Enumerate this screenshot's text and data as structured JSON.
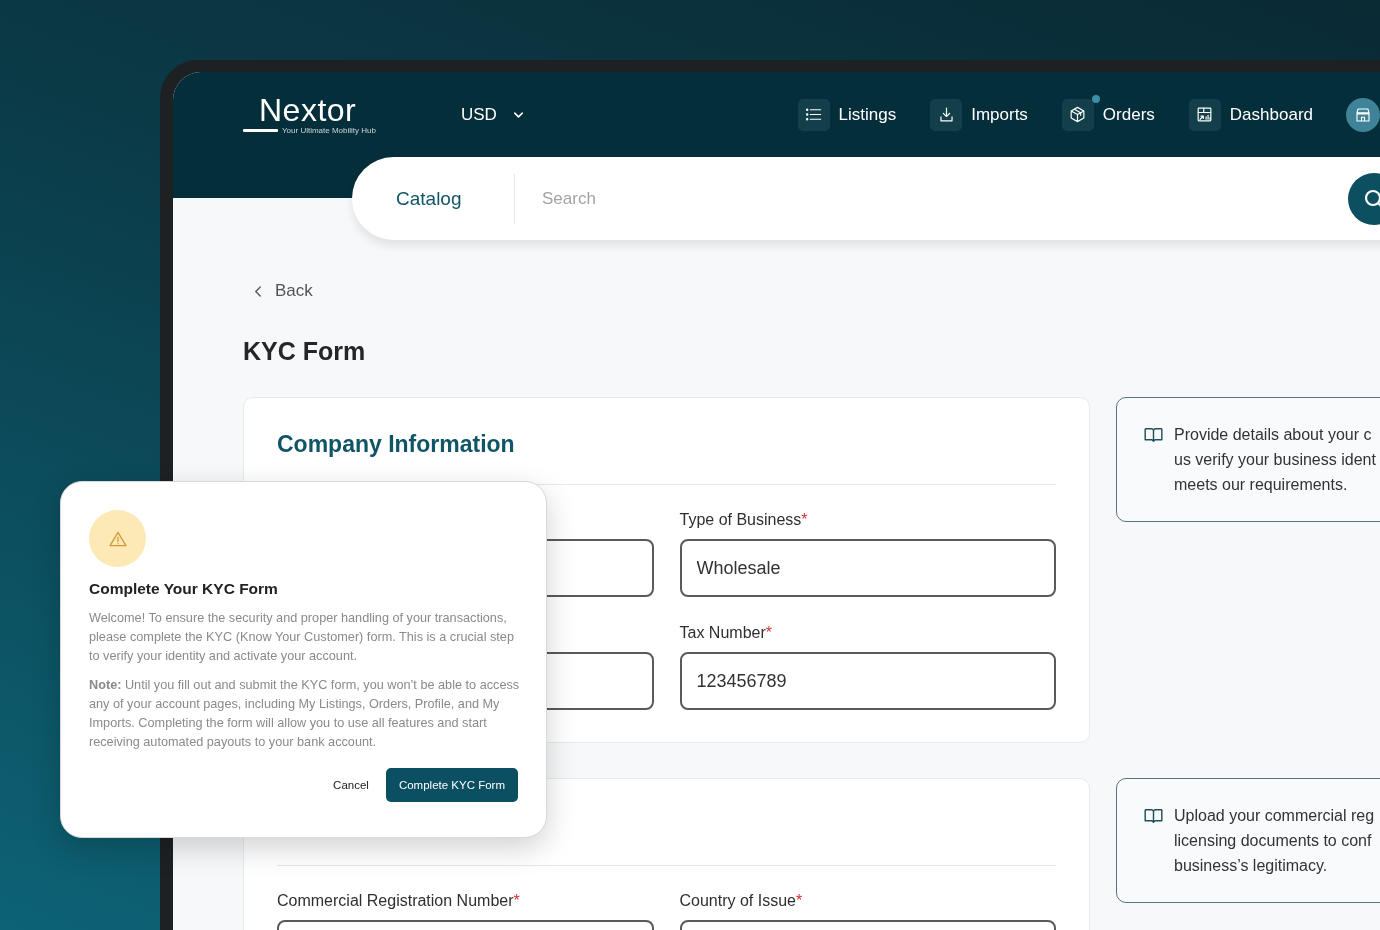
{
  "logo": {
    "name": "Nextor",
    "tagline": "Your Ultimate Mobility Hub"
  },
  "currency": {
    "label": "USD"
  },
  "nav": [
    {
      "label": "Listings",
      "notification": false
    },
    {
      "label": "Imports",
      "notification": false
    },
    {
      "label": "Orders",
      "notification": true
    },
    {
      "label": "Dashboard",
      "notification": false
    }
  ],
  "search_bar": {
    "category": "Catalog",
    "placeholder": "Search"
  },
  "back_link": {
    "label": "Back"
  },
  "page_title": "KYC Form",
  "sections": [
    {
      "title": "Company Information",
      "fields": [
        {
          "kind": "text_input"
        },
        {
          "kind": "text_input",
          "label": "Type of Business",
          "required_mark": "*",
          "value": "Wholesale"
        },
        {
          "kind": "text_input"
        },
        {
          "kind": "text_input",
          "label": "Tax Number",
          "required_mark": "*",
          "value": "123456789"
        }
      ],
      "info_lines": [
        "Provide details about your c",
        "us verify your business ident",
        "meets our requirements."
      ]
    },
    {
      "fields": [
        {
          "kind": "text_input",
          "label": "Commercial Registration Number",
          "required_mark": "*"
        },
        {
          "kind": "text_input",
          "label": "Country of Issue",
          "required_mark": "*"
        }
      ],
      "info_lines": [
        "Upload your commercial reg",
        "licensing documents to conf",
        "business’s legitimacy."
      ]
    }
  ],
  "modal": {
    "title": "Complete Your KYC Form",
    "paragraphs": [
      "Welcome! To ensure the security and proper handling of your transactions, please complete the KYC (Know Your Customer) form. This is a crucial step to verify your identity and activate your account.",
      "**Note:** Until you fill out and submit the KYC form, you won’t be able to access any of your account pages, including My Listings, Orders, Profile, and My Imports. Completing the form will allow you to use all features and start receiving automated payouts to your bank account."
    ],
    "buttons": [
      {
        "label": "Cancel",
        "kind": "text"
      },
      {
        "label": "Complete KYC Form",
        "kind": "primary"
      }
    ]
  }
}
